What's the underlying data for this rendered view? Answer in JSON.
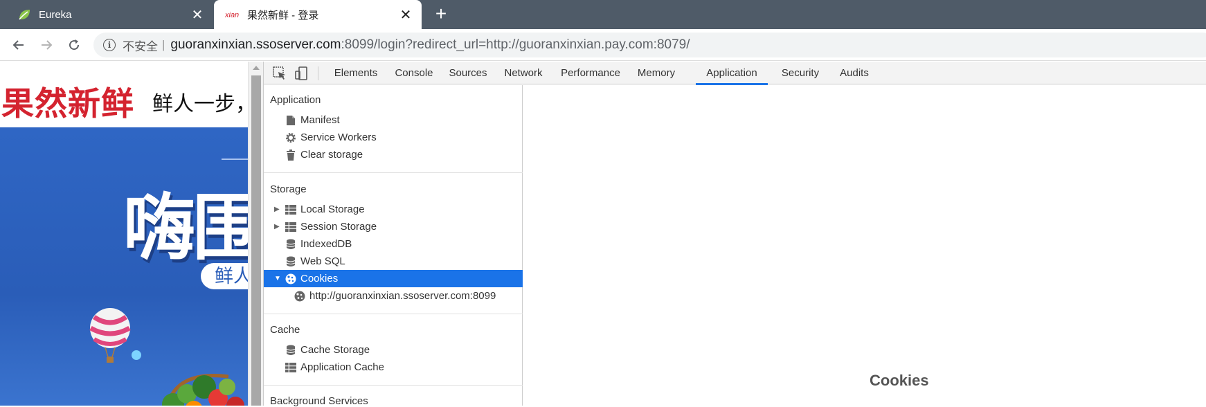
{
  "browser": {
    "tabs": [
      {
        "title": "Eureka",
        "favicon": "spring-leaf-icon"
      },
      {
        "title": "果然新鲜 - 登录",
        "favicon": "xian-logo-icon"
      }
    ],
    "address": {
      "security_label": "不安全",
      "url_host": "guoranxinxian.ssoserver.com",
      "url_rest": ":8099/login?redirect_url=http://guoranxinxian.pay.com:8079/"
    }
  },
  "page": {
    "logo": "果然新鲜",
    "slogan": "鲜人一步，",
    "banner_big": "嗨围",
    "banner_pill": "鲜人"
  },
  "devtools": {
    "tabs": [
      "Elements",
      "Console",
      "Sources",
      "Network",
      "Performance",
      "Memory",
      "Application",
      "Security",
      "Audits"
    ],
    "selected_tab": "Application",
    "sidebar": {
      "application": {
        "title": "Application",
        "items": [
          "Manifest",
          "Service Workers",
          "Clear storage"
        ]
      },
      "storage": {
        "title": "Storage",
        "items": [
          "Local Storage",
          "Session Storage",
          "IndexedDB",
          "Web SQL",
          "Cookies"
        ],
        "cookie_child": "http://guoranxinxian.ssoserver.com:8099"
      },
      "cache": {
        "title": "Cache",
        "items": [
          "Cache Storage",
          "Application Cache"
        ]
      },
      "background": {
        "title": "Background Services"
      }
    },
    "main": {
      "title": "Cookies"
    }
  },
  "colors": {
    "tabstrip": "#4f5b68",
    "accent": "#1a73e8",
    "logo_red": "#d4232f",
    "banner_blue": "#2a5db8"
  }
}
